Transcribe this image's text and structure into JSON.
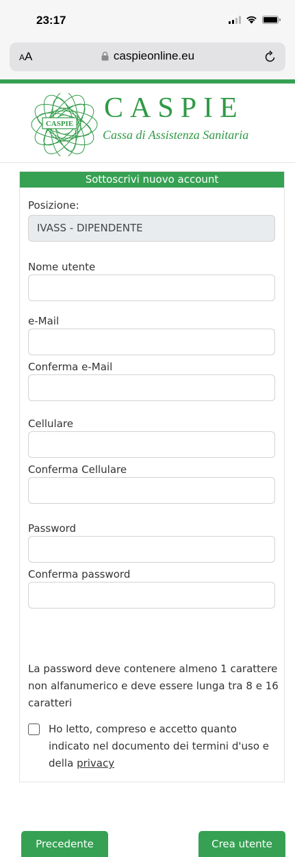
{
  "status_bar": {
    "time": "23:17"
  },
  "browser": {
    "aa_small": "A",
    "aa_large": "A",
    "url": "caspieonline.eu"
  },
  "brand": {
    "name": "CASPIE",
    "emblem_text": "CASPIE",
    "tagline": "Cassa di Assistenza Sanitaria",
    "color": "#36a153"
  },
  "form": {
    "title": "Sottoscrivi nuovo account",
    "position_label": "Posizione:",
    "position_value": "IVASS - DIPENDENTE",
    "fields": [
      {
        "label": "Nome utente",
        "value": "",
        "placeholder": ""
      },
      {
        "label": "e-Mail",
        "value": "",
        "placeholder": ""
      },
      {
        "label": "Conferma e-Mail",
        "value": "",
        "placeholder": ""
      },
      {
        "label": "Cellulare",
        "value": "",
        "placeholder": ""
      },
      {
        "label": "Conferma Cellulare",
        "value": "",
        "placeholder": ""
      },
      {
        "label": "Password",
        "value": "",
        "placeholder": ""
      },
      {
        "label": "Conferma password",
        "value": "",
        "placeholder": ""
      }
    ],
    "password_hint": "La password deve contenere almeno 1 carattere non alfanumerico e deve essere lunga tra 8 e 16 caratteri",
    "consent_text": "Ho letto, compreso e accetto quanto indicato nel documento dei termini d'uso e della",
    "consent_link": "privacy",
    "consent_checked": false
  },
  "buttons": {
    "previous": "Precedente",
    "create": "Crea utente"
  }
}
